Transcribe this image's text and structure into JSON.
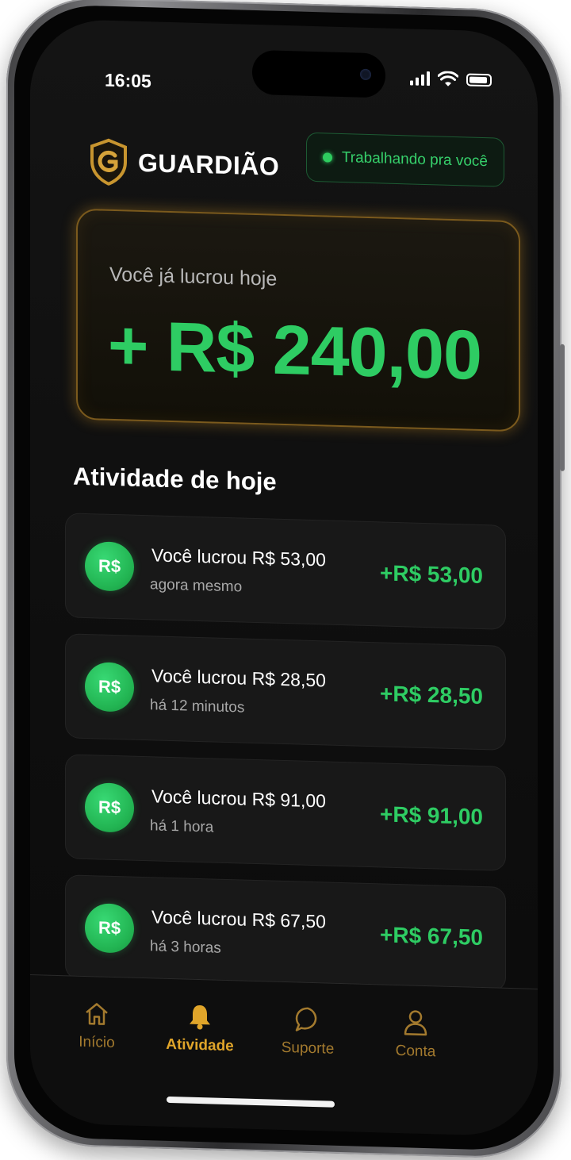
{
  "status_bar": {
    "time": "16:05",
    "signal_icon": "cellular-signal-icon",
    "wifi_icon": "wifi-icon",
    "battery_icon": "battery-icon"
  },
  "header": {
    "logo_icon": "shield-g-logo-icon",
    "brand": "GUARDIÃO",
    "status_text": "Trabalhando pra você"
  },
  "profit_card": {
    "label": "Você já lucrou hoje",
    "value": "+ R$ 240,00"
  },
  "activity": {
    "title": "Atividade de hoje",
    "items": [
      {
        "coin": "R$",
        "title": "Você lucrou R$ 53,00",
        "time": "agora mesmo",
        "amount": "+R$ 53,00"
      },
      {
        "coin": "R$",
        "title": "Você lucrou R$ 28,50",
        "time": "há 12 minutos",
        "amount": "+R$ 28,50"
      },
      {
        "coin": "R$",
        "title": "Você lucrou R$ 91,00",
        "time": "há 1 hora",
        "amount": "+R$ 91,00"
      },
      {
        "coin": "R$",
        "title": "Você lucrou R$ 67,50",
        "time": "há 3 horas",
        "amount": "+R$ 67,50"
      }
    ]
  },
  "nav": {
    "items": [
      {
        "label": "Início",
        "icon": "home-icon"
      },
      {
        "label": "Atividade",
        "icon": "bell-icon",
        "active": true
      },
      {
        "label": "Suporte",
        "icon": "chat-bubble-icon"
      },
      {
        "label": "Conta",
        "icon": "user-icon"
      }
    ]
  },
  "colors": {
    "accent_green": "#2ecc63",
    "accent_gold": "#e0a52a",
    "background": "#0e0e0e"
  }
}
